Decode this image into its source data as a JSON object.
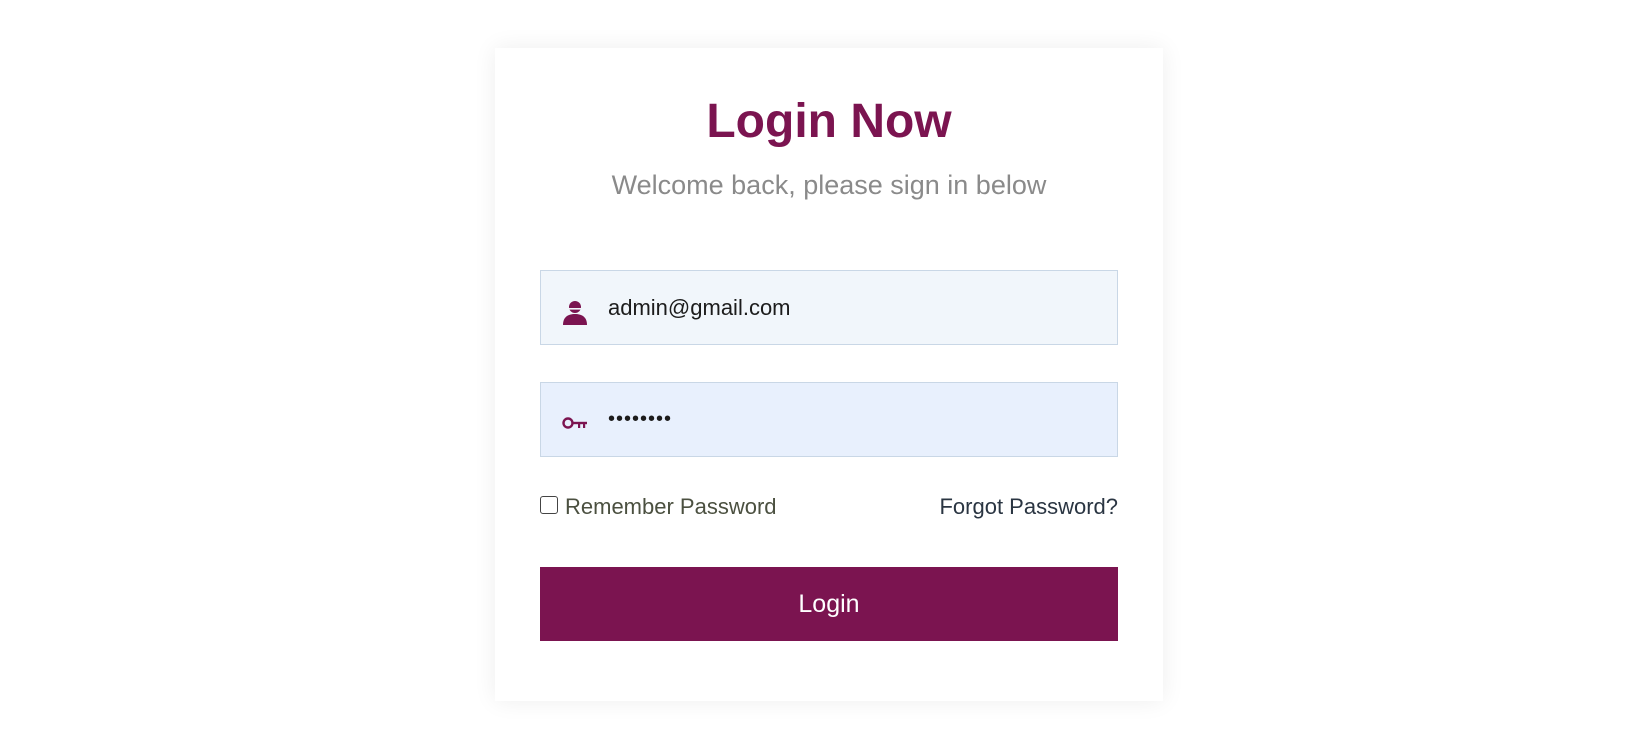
{
  "colors": {
    "accent": "#7b1450",
    "subtitle": "#8a8a8a",
    "email_field_bg": "#f1f6fb",
    "password_field_bg": "#e8f0fd"
  },
  "login": {
    "title": "Login Now",
    "subtitle": "Welcome back, please sign in below",
    "email": {
      "value": "admin@gmail.com",
      "icon": "user-icon"
    },
    "password": {
      "value": "12345678",
      "icon": "key-icon"
    },
    "remember": {
      "label": "Remember Password",
      "checked": false
    },
    "forgot_label": "Forgot Password?",
    "submit_label": "Login"
  }
}
